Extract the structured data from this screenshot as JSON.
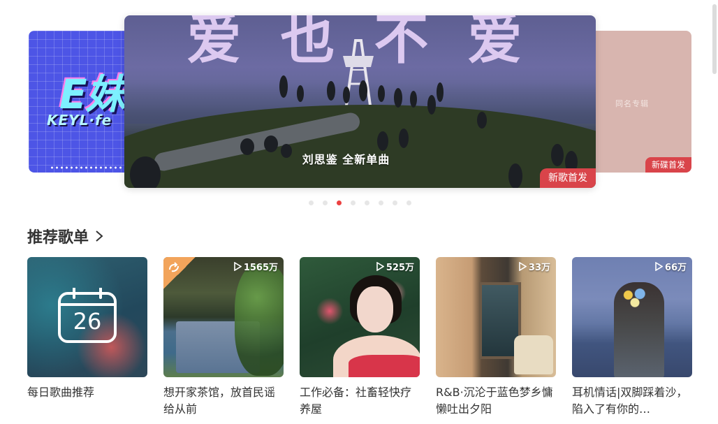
{
  "banner": {
    "slides": [
      {
        "position": "left",
        "logo_text": "E妹",
        "sub_logo": "KEYL·fe"
      },
      {
        "position": "center",
        "big_title": "爱也不爱",
        "subtitle": "刘思鉴 全新单曲",
        "tag": "新歌首发",
        "tag_color": "#d9444a"
      },
      {
        "position": "right",
        "album_text": "同名专辑",
        "tag": "新碟首发",
        "tag_color": "#d9444a"
      }
    ],
    "indicator": {
      "count": 8,
      "active_index": 2,
      "active_color": "#ec4141"
    }
  },
  "section": {
    "title": "推荐歌单",
    "chevron_icon": "chevron-right-icon"
  },
  "playlists": [
    {
      "title": "每日歌曲推荐",
      "play_count": "",
      "calendar_day": "26",
      "icon": "calendar-icon"
    },
    {
      "title": "想开家茶馆，放首民谣给从前",
      "play_count": "1565万",
      "corner_icon": "sync-icon"
    },
    {
      "title": "工作必备：社畜轻快疗养屋",
      "play_count": "525万"
    },
    {
      "title": "R&B·沉沦于蓝色梦乡慵懒吐出夕阳",
      "play_count": "33万"
    },
    {
      "title": "耳机情话|双脚踩着沙，陷入了有你的…",
      "play_count": "66万"
    }
  ],
  "colors": {
    "accent": "#ec4141",
    "text": "#333333"
  }
}
